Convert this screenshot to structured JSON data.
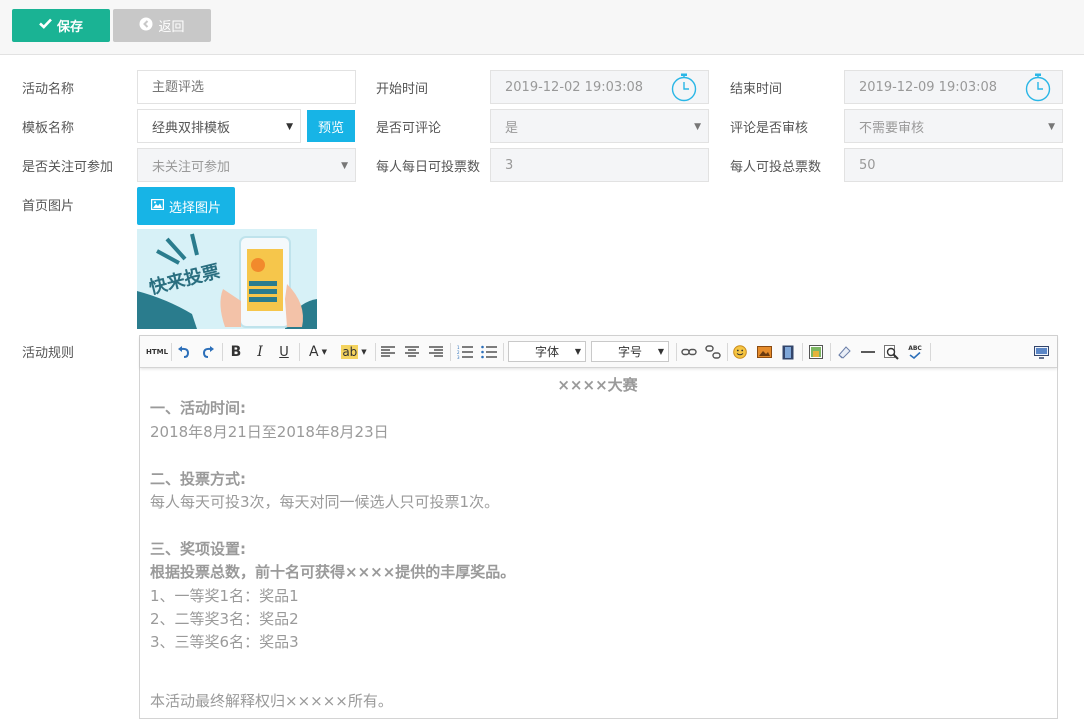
{
  "toolbar": {
    "save_label": "保存",
    "back_label": "返回"
  },
  "form": {
    "activity_name": {
      "label": "活动名称",
      "placeholder": "主题评选"
    },
    "start_time": {
      "label": "开始时间",
      "value": "2019-12-02 19:03:08"
    },
    "end_time": {
      "label": "结束时间",
      "value": "2019-12-09 19:03:08"
    },
    "template": {
      "label": "模板名称",
      "value": "经典双排模板",
      "preview_label": "预览"
    },
    "allow_comment": {
      "label": "是否可评论",
      "value": "是"
    },
    "comment_review": {
      "label": "评论是否审核",
      "value": "不需要审核"
    },
    "follow_required": {
      "label": "是否关注可参加",
      "value": "未关注可参加"
    },
    "daily_votes": {
      "label": "每人每日可投票数",
      "value": "3"
    },
    "total_votes": {
      "label": "每人可投总票数",
      "value": "50"
    },
    "cover_image": {
      "label": "首页图片",
      "button_label": "选择图片",
      "image_text": "快来投票"
    },
    "rules": {
      "label": "活动规则"
    }
  },
  "editor": {
    "toolbar": {
      "html_label": "HTML",
      "font_label": "字体",
      "size_label": "字号"
    },
    "content": {
      "title": "××××大赛",
      "section1_heading": "一、活动时间:",
      "section1_text": "2018年8月21日至2018年8月23日",
      "section2_heading": "二、投票方式:",
      "section2_text": "每人每天可投3次，每天对同一候选人只可投票1次。",
      "section3_heading": "三、奖项设置:",
      "section3_bold": "根据投票总数，前十名可获得××××提供的丰厚奖品。",
      "prize1": "1、一等奖1名：奖品1",
      "prize2": "2、二等奖3名：奖品2",
      "prize3": "3、三等奖6名：奖品3",
      "footer": "本活动最终解释权归×××××所有。"
    }
  },
  "colors": {
    "primary": "#1ab394",
    "info": "#17b4e6",
    "muted": "#c8c8c8"
  }
}
